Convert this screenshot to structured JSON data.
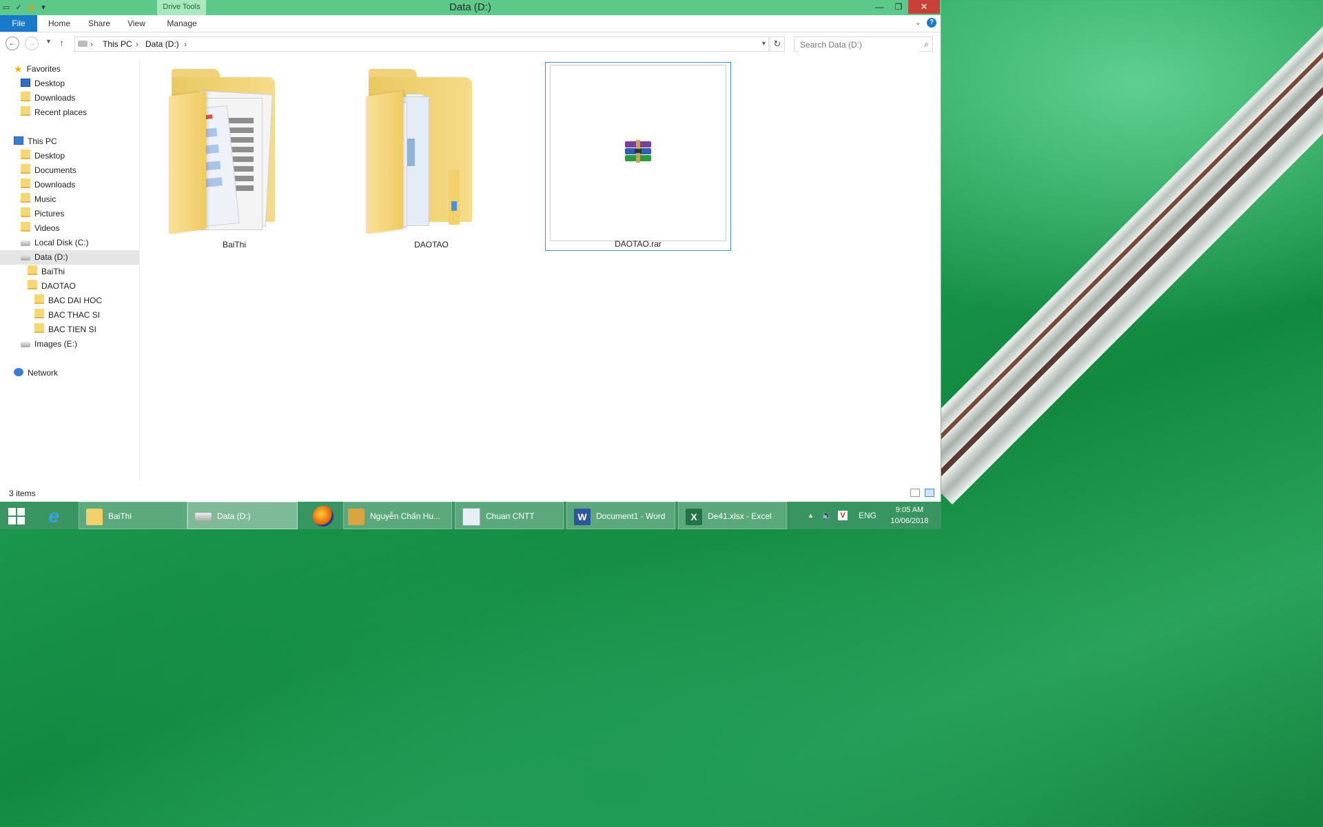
{
  "window": {
    "title": "Data (D:)",
    "context_tab": "Drive Tools",
    "close_symbol": "✕",
    "minimize_symbol": "—",
    "maximize_symbol": "❐"
  },
  "ribbon": {
    "tabs": [
      "File",
      "Home",
      "Share",
      "View",
      "Manage"
    ]
  },
  "address": {
    "crumbs": [
      "This PC",
      "Data (D:)"
    ],
    "separator": "›",
    "search_placeholder": "Search Data (D:)"
  },
  "nav_pane": {
    "items": [
      {
        "label": "Favorites",
        "icon": "star-icon"
      },
      {
        "label": "Desktop",
        "icon": "desktop-icon"
      },
      {
        "label": "Downloads",
        "icon": "downloads-folder-icon"
      },
      {
        "label": "Recent places",
        "icon": "recent-places-icon"
      },
      {
        "label": "This PC",
        "icon": "computer-icon"
      },
      {
        "label": "Desktop",
        "icon": "folder-icon"
      },
      {
        "label": "Documents",
        "icon": "folder-icon"
      },
      {
        "label": "Downloads",
        "icon": "folder-icon"
      },
      {
        "label": "Music",
        "icon": "folder-icon"
      },
      {
        "label": "Pictures",
        "icon": "folder-icon"
      },
      {
        "label": "Videos",
        "icon": "folder-icon"
      },
      {
        "label": "Local Disk (C:)",
        "icon": "drive-icon"
      },
      {
        "label": "Data (D:)",
        "icon": "drive-icon"
      },
      {
        "label": "BaiThi",
        "icon": "folder-icon"
      },
      {
        "label": "DAOTAO",
        "icon": "folder-icon"
      },
      {
        "label": "BAC DAI HOC",
        "icon": "folder-icon"
      },
      {
        "label": "BAC THAC SI",
        "icon": "folder-icon"
      },
      {
        "label": "BAC TIEN SI",
        "icon": "folder-icon"
      },
      {
        "label": "Images (E:)",
        "icon": "drive-icon"
      },
      {
        "label": "Network",
        "icon": "network-icon"
      }
    ],
    "selected": "Data (D:)"
  },
  "files": [
    {
      "name": "BaiThi",
      "type": "folder"
    },
    {
      "name": "DAOTAO",
      "type": "folder"
    },
    {
      "name": "DAOTAO.rar",
      "type": "rar-archive",
      "selected": true
    }
  ],
  "status": {
    "item_count": "3 items"
  },
  "taskbar": {
    "items": [
      {
        "label": "BaiThi",
        "icon": "folder-icon"
      },
      {
        "label": "Data (D:)",
        "icon": "drive-icon",
        "active": true
      },
      {
        "label": "Nguyễn Chấn Hu...",
        "icon": "app-icon"
      },
      {
        "label": "Chuan CNTT",
        "icon": "presentation-icon"
      },
      {
        "label": "Document1 - Word",
        "icon": "word-icon"
      },
      {
        "label": "De41.xlsx - Excel",
        "icon": "excel-icon"
      }
    ],
    "language": "ENG",
    "time": "9:05 AM",
    "date": "10/06/2018"
  },
  "colors": {
    "titlebar": "#5cc88a",
    "file_tab": "#1979ca",
    "close_button": "#c7403a",
    "selection_border": "#3c8fd6"
  }
}
